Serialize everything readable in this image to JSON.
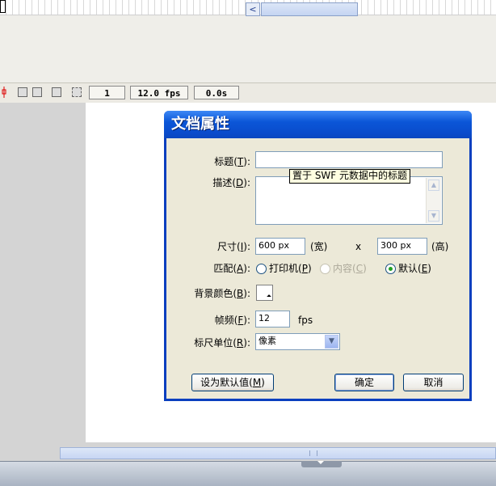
{
  "timeline": {
    "frame_number": "1",
    "frame_rate": "12.0 fps",
    "elapsed_time": "0.0s",
    "scroll_left_arrow": "<"
  },
  "dialog": {
    "title": "文档属性",
    "title_label": {
      "text": "标题(",
      "key": "T",
      "end": "):"
    },
    "desc_label": {
      "text": "描述(",
      "key": "D",
      "end": "):"
    },
    "tooltip": "置于 SWF 元数据中的标题",
    "size_label": {
      "text": "尺寸(",
      "key": "I",
      "end": "):"
    },
    "width_value": "600 px",
    "width_suffix": "(宽)",
    "times": "x",
    "height_value": "300 px",
    "height_suffix": "(高)",
    "match_label": {
      "text": "匹配(",
      "key": "A",
      "end": "):"
    },
    "match_options": [
      {
        "text": "打印机(",
        "key": "P",
        "end": ")",
        "selected": false,
        "enabled": true
      },
      {
        "text": "内容(",
        "key": "C",
        "end": ")",
        "selected": false,
        "enabled": false
      },
      {
        "text": "默认(",
        "key": "E",
        "end": ")",
        "selected": true,
        "enabled": true
      }
    ],
    "bg_label": {
      "text": "背景颜色(",
      "key": "B",
      "end": "):"
    },
    "bg_color": "#ffffff",
    "fps_label": {
      "text": "帧频(",
      "key": "F",
      "end": "):"
    },
    "fps_value": "12",
    "fps_unit": "fps",
    "ruler_label": {
      "text": "标尺单位(",
      "key": "R",
      "end": "):"
    },
    "ruler_value": "像素",
    "default_button": {
      "text": "设为默认值(",
      "key": "M",
      "end": ")"
    },
    "ok_button": "确定",
    "cancel_button": "取消"
  },
  "colors": {
    "titlebar": "#0a4ccc",
    "dialog_bg": "#ece9d8",
    "selected_radio": "#21a121"
  }
}
